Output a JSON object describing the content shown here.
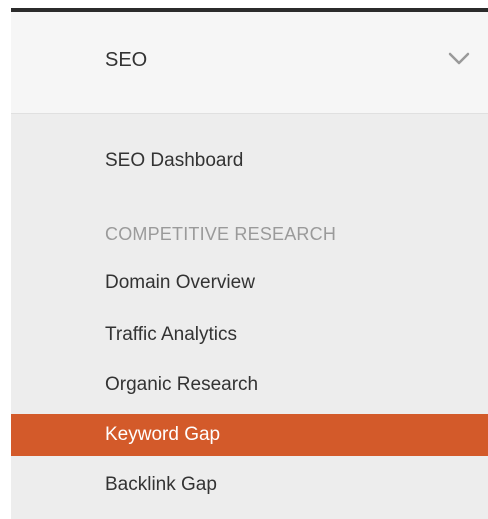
{
  "seo_menu": {
    "header": {
      "title": "SEO",
      "chevron_icon": "chevron-down-icon"
    },
    "items": [
      {
        "label": "SEO Dashboard"
      }
    ],
    "section": {
      "label": "COMPETITIVE RESEARCH",
      "items": [
        {
          "label": "Domain Overview"
        },
        {
          "label": "Traffic Analytics"
        },
        {
          "label": "Organic Research"
        },
        {
          "label": "Keyword Gap",
          "active": true
        },
        {
          "label": "Backlink Gap"
        }
      ]
    },
    "colors": {
      "active_bg": "#d35a2a",
      "section_label": "#9a9a9a",
      "text": "#333333",
      "panel_bg": "#ededed",
      "header_bg": "#f6f6f6"
    }
  }
}
